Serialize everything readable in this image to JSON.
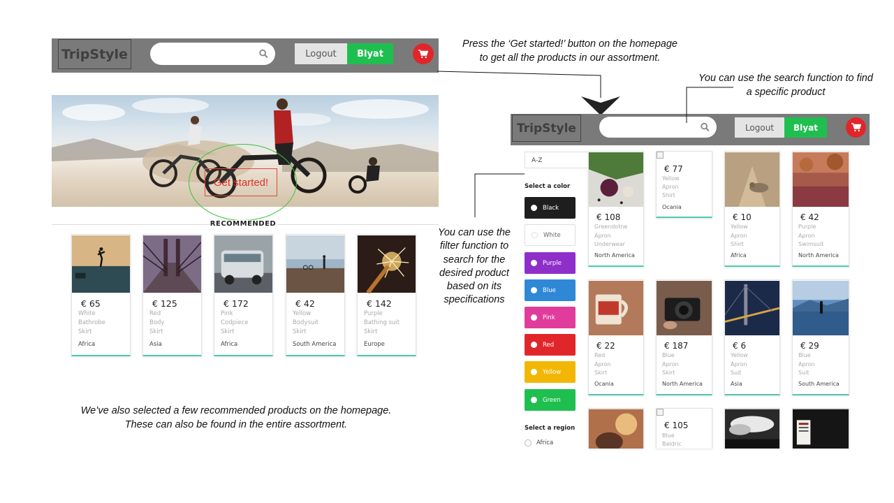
{
  "home": {
    "brand": "TripStyle",
    "logout": "Logout",
    "user": "Blyat",
    "cta": "Get started!",
    "recommended_title": "RECOMMENDED",
    "recommended": [
      {
        "price": "€ 65",
        "color": "White",
        "type": "Bathrobe",
        "cat": "Skirt",
        "region": "Africa"
      },
      {
        "price": "€ 125",
        "color": "Red",
        "type": "Body",
        "cat": "Skirt",
        "region": "Asia"
      },
      {
        "price": "€ 172",
        "color": "Pink",
        "type": "Codpiece",
        "cat": "Skirt",
        "region": "Africa"
      },
      {
        "price": "€ 42",
        "color": "Yellow",
        "type": "Bodysuit",
        "cat": "Skirt",
        "region": "South America"
      },
      {
        "price": "€ 142",
        "color": "Purple",
        "type": "Bathing suit",
        "cat": "Skirt",
        "region": "Europe"
      }
    ]
  },
  "shop": {
    "brand": "TripStyle",
    "logout": "Logout",
    "user": "Blyat",
    "sort": "A-Z",
    "color_heading": "Select a color",
    "colors": [
      {
        "label": "Black",
        "hex": "#1e1e1e"
      },
      {
        "label": "White",
        "hex": "#ffffff"
      },
      {
        "label": "Purple",
        "hex": "#8e2fc9"
      },
      {
        "label": "Blue",
        "hex": "#2f88d6"
      },
      {
        "label": "Pink",
        "hex": "#e03c9b"
      },
      {
        "label": "Red",
        "hex": "#e0262b"
      },
      {
        "label": "Yellow",
        "hex": "#f2b705"
      },
      {
        "label": "Green",
        "hex": "#1fbf4f"
      }
    ],
    "region_heading": "Select a region",
    "regions": [
      "Africa"
    ],
    "products": [
      {
        "price": "€ 108",
        "color": "Greendotne",
        "type": "Apron",
        "cat": "Underwear",
        "region": "North America"
      },
      {
        "price": "€ 77",
        "color": "Yellow",
        "type": "Apron",
        "cat": "Shirt",
        "region": "Ocania"
      },
      {
        "price": "€ 10",
        "color": "Yellow",
        "type": "Apron",
        "cat": "Shirt",
        "region": "Africa"
      },
      {
        "price": "€ 42",
        "color": "Purple",
        "type": "Apron",
        "cat": "Swimsuit",
        "region": "North America"
      },
      {
        "price": "€ 22",
        "color": "Red",
        "type": "Apron",
        "cat": "Skirt",
        "region": "Ocania"
      },
      {
        "price": "€ 187",
        "color": "Blue",
        "type": "Apron",
        "cat": "Skirt",
        "region": "North America"
      },
      {
        "price": "€ 6",
        "color": "Yellow",
        "type": "Apron",
        "cat": "Suit",
        "region": "Asia"
      },
      {
        "price": "€ 29",
        "color": "Blue",
        "type": "Apron",
        "cat": "Suit",
        "region": "South America"
      },
      {
        "price": "€ 105",
        "color": "Blue",
        "type": "Baldric",
        "cat": "",
        "region": ""
      }
    ]
  },
  "annotations": {
    "get_started": "Press the ‘Get started!’ button on the homepage\nto get all the products in our assortment.",
    "search": "You can use the search function to find\na specific product",
    "filter": "You can use the\nfilter function to\nsearch for the\ndesired product\nbased on its\nspecifications",
    "recommended": "We’ve also selected a few recommended products on the homepage.\nThese can also be found in the entire assortment."
  }
}
